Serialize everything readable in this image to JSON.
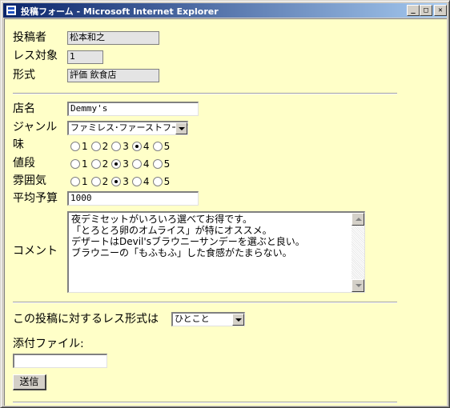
{
  "window": {
    "title": "投稿フォーム - Microsoft Internet Explorer",
    "minimize": "_",
    "maximize": "□",
    "close": "✕"
  },
  "post_info": {
    "author_label": "投稿者",
    "author_value": "松本和之",
    "reply_target_label": "レス対象",
    "reply_target_value": "1",
    "format_label": "形式",
    "format_value": "評価 飲食店"
  },
  "form": {
    "shop_name_label": "店名",
    "shop_name_value": "Demmy's",
    "genre_label": "ジャンル",
    "genre_value": "ファミレス･ファーストフード",
    "taste_label": "味",
    "price_label": "値段",
    "atmosphere_label": "雰囲気",
    "rating_options": [
      "1",
      "2",
      "3",
      "4",
      "5"
    ],
    "taste_selected": "4",
    "price_selected": "3",
    "atmosphere_selected": "3",
    "budget_label": "平均予算",
    "budget_value": "1000",
    "comment_label": "コメント",
    "comment_lines": [
      "夜デミセットがいろいろ選べてお得です。",
      "「とろとろ卵のオムライス」が特にオススメ。",
      "デザートはDevil'sブラウニーサンデーを選ぶと良い。",
      "ブラウニーの「もふもふ」した食感がたまらない。"
    ]
  },
  "reply": {
    "label": "この投稿に対するレス形式は",
    "value": "ひとこと"
  },
  "attachment": {
    "label": "添付ファイル:",
    "value": ""
  },
  "submit_label": "送信",
  "colors": {
    "page_background": "#ffffc8",
    "titlebar_start": "#0a246a",
    "titlebar_end": "#a6caf0",
    "readonly_field": "#e4e4e4"
  }
}
